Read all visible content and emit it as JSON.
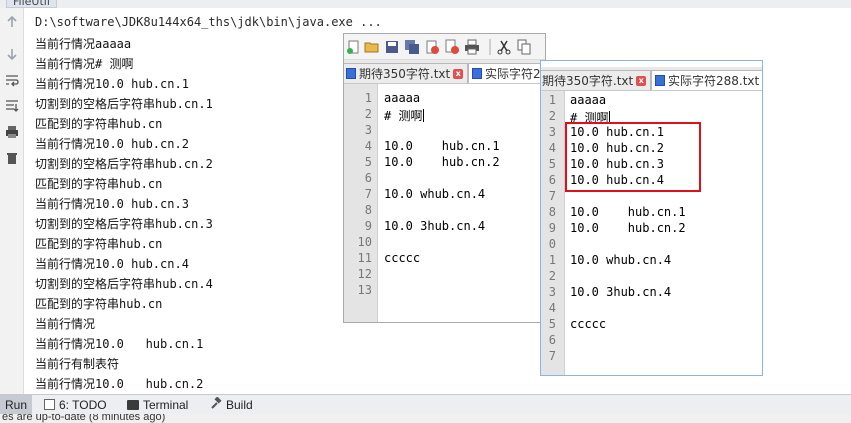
{
  "ide": {
    "tab_title": "FileUtil",
    "command": "D:\\software\\JDK8u144x64_ths\\jdk\\bin\\java.exe ...",
    "console_lines": [
      "当前行情况aaaaa",
      "当前行情况# 测啊",
      "当前行情况10.0 hub.cn.1",
      "切割到的空格后字符串hub.cn.1",
      "匹配到的字符串hub.cn",
      "当前行情况10.0 hub.cn.2",
      "切割到的空格后字符串hub.cn.2",
      "匹配到的字符串hub.cn",
      "当前行情况10.0 hub.cn.3",
      "切割到的空格后字符串hub.cn.3",
      "匹配到的字符串hub.cn",
      "当前行情况10.0 hub.cn.4",
      "切割到的空格后字符串hub.cn.4",
      "匹配到的字符串hub.cn",
      "当前行情况",
      "当前行情况10.0   hub.cn.1",
      "当前行有制表符",
      "当前行情况10.0   hub.cn.2"
    ],
    "gutter_icons": [
      "arrow-up-icon",
      "arrow-down-icon",
      "soft-wrap-icon",
      "scroll-to-end-icon",
      "print-icon",
      "trash-icon"
    ],
    "statusbar": {
      "run_label": "Run",
      "todo_label": "6: TODO",
      "terminal_label": "Terminal",
      "build_label": "Build"
    },
    "bottom_message": "es are up-to-date (8 minutes ago)"
  },
  "notepad_left": {
    "tabs": [
      {
        "label": "期待350字符.txt",
        "active": true
      },
      {
        "label": "实际字符2",
        "active": false
      }
    ],
    "line_numbers": [
      "1",
      "2",
      "3",
      "4",
      "5",
      "6",
      "7",
      "8",
      "9",
      "10",
      "11",
      "12",
      "13"
    ],
    "lines": [
      "aaaaa",
      "# 测啊",
      "",
      "10.0    hub.cn.1",
      "10.0    hub.cn.2",
      "",
      "10.0 whub.cn.4",
      "",
      "10.0 3hub.cn.4",
      "",
      "ccccc",
      "",
      ""
    ]
  },
  "notepad_right": {
    "tabs": [
      {
        "label": "期待350字符.txt",
        "active": true
      },
      {
        "label": "实际字符288.txt",
        "active": false
      }
    ],
    "line_numbers": [
      "1",
      "2",
      "3",
      "4",
      "5",
      "6",
      "7",
      "8",
      "9",
      "0",
      "1",
      "2",
      "3",
      "4",
      "5",
      "6",
      "7"
    ],
    "lines": [
      "aaaaa",
      "# 测啊",
      "10.0 hub.cn.1",
      "10.0 hub.cn.2",
      "10.0 hub.cn.3",
      "10.0 hub.cn.4",
      "",
      "10.0    hub.cn.1",
      "10.0    hub.cn.2",
      "",
      "10.0 whub.cn.4",
      "",
      "10.0 3hub.cn.4",
      "",
      "ccccc",
      "",
      ""
    ]
  },
  "colors": {
    "highlight": "#e0101a",
    "console_bg": "#ffffff",
    "linenum_bg": "#e4e4e4"
  }
}
